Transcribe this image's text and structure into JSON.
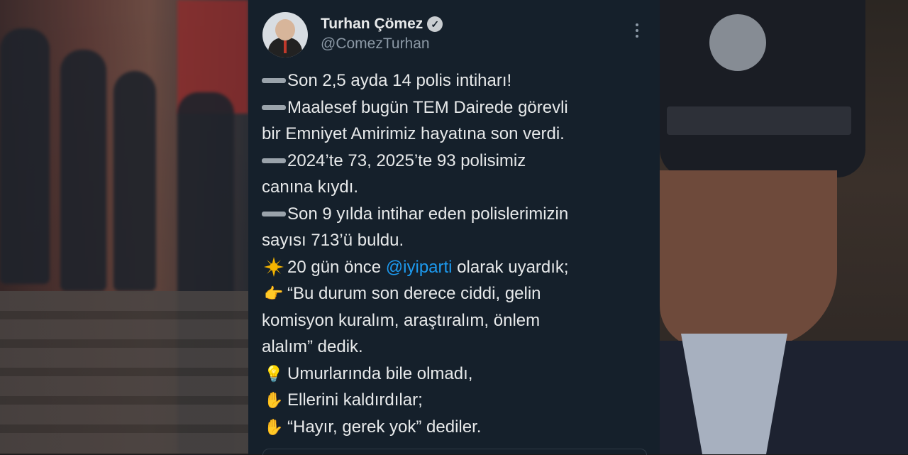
{
  "tweet": {
    "author_name": "Turhan Çömez",
    "author_handle": "@ComezTurhan",
    "lines": [
      {
        "emoji": "dash-icon",
        "text": "Son 2,5 ayda 14 polis intiharı!"
      },
      {
        "emoji": "dash-icon",
        "text": "Maalesef bugün TEM Dairede görevli"
      },
      {
        "emoji": "",
        "text": "bir Emniyet Amirimiz hayatına son verdi."
      },
      {
        "emoji": "dash-icon",
        "text": "2024’te 73, 2025’te 93 polisimiz"
      },
      {
        "emoji": "",
        "text": "canına kıydı."
      },
      {
        "emoji": "dash-icon",
        "text": "Son 9 yılda intihar eden polislerimizin"
      },
      {
        "emoji": "",
        "text": "sayısı 713’ü buldu."
      },
      {
        "emoji": "sun-icon",
        "text_before": "20 gün önce ",
        "mention": "@iyiparti",
        "text_after": " olarak uyardık;"
      },
      {
        "emoji": "pointing-hand-icon",
        "text": "“Bu durum son derece ciddi, gelin"
      },
      {
        "emoji": "",
        "text": "komisyon kuralım, araştıralım, önlem"
      },
      {
        "emoji": "",
        "text": "alalım” dedik."
      },
      {
        "emoji": "light-bulb-icon",
        "text": "Umurlarında bile olmadı,"
      },
      {
        "emoji": "raised-hand-icon",
        "text": "Ellerini kaldırdılar;"
      },
      {
        "emoji": "raised-hand-icon",
        "text": "“Hayır, gerek yok” dediler."
      }
    ]
  },
  "colors": {
    "card_background": "#15202b",
    "text": "#e7e9ea",
    "secondary_text": "#8b98a5",
    "mention": "#1d9bf0"
  }
}
